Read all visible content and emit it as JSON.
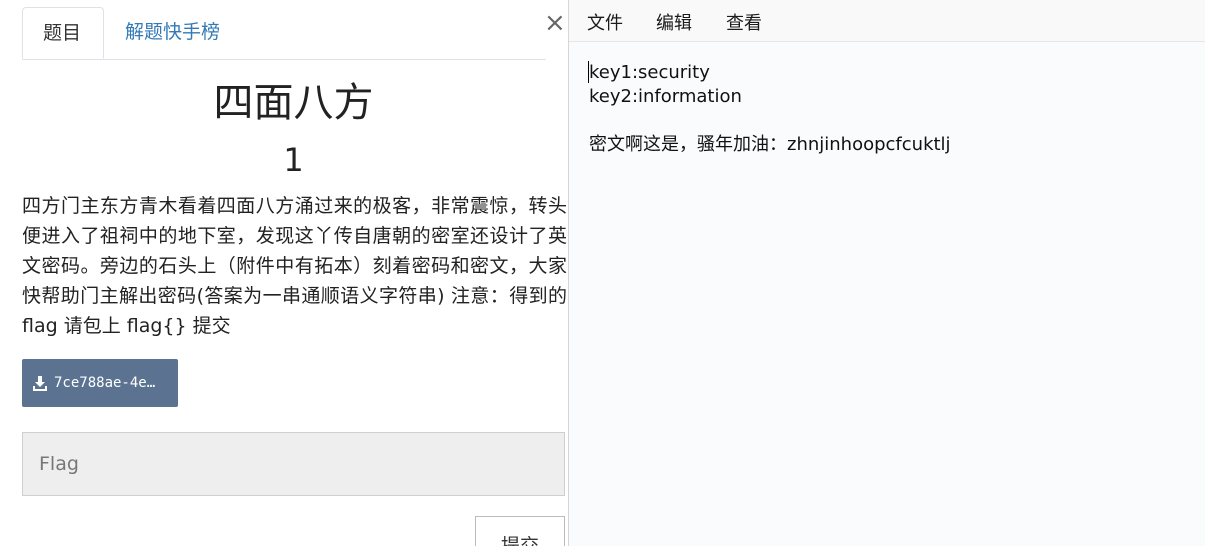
{
  "challenge": {
    "tabs": [
      "题目",
      "解题快手榜"
    ],
    "title": "四面八方",
    "points": "1",
    "description": "四方门主东方青木看着四面八方涌过来的极客，非常震惊，转头便进入了祖祠中的地下室，发现这丫传自唐朝的密室还设计了英文密码。旁边的石头上（附件中有拓本）刻着密码和密文，大家快帮助门主解出密码(答案为一串通顺语义字符串) 注意：得到的 flag 请包上 flag{} 提交",
    "attachment_label": "7ce788ae-4e…",
    "flag_placeholder": "Flag",
    "submit_label": "提交",
    "close_symbol": "×"
  },
  "notepad": {
    "menu": [
      "文件",
      "编辑",
      "查看"
    ],
    "lines": [
      "key1:security",
      "key2:information",
      "",
      "密文啊这是，骚年加油：zhnjinhoopcfcuktlj"
    ]
  },
  "colors": {
    "link": "#337ab7",
    "download_button": "#5b7391",
    "input_bg": "#eeeeee"
  }
}
